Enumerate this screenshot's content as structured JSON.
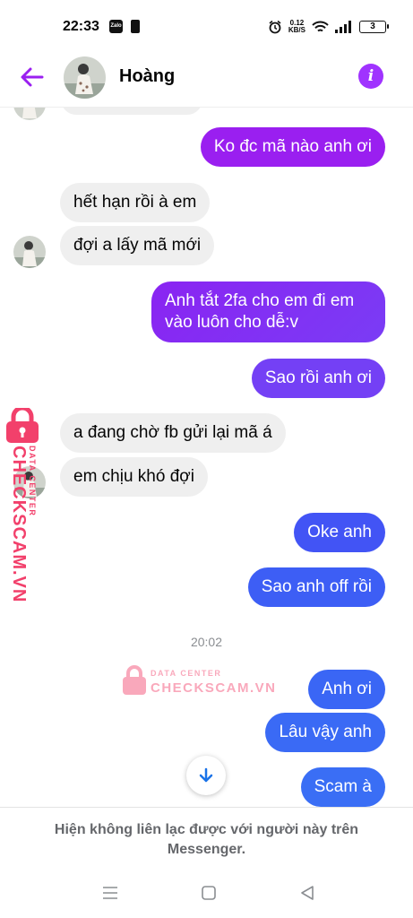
{
  "status_bar": {
    "time": "22:33",
    "app_icon_label": "Zalo",
    "net_speed_value": "0.12",
    "net_speed_unit": "KB/S",
    "battery": "3"
  },
  "header": {
    "contact_name": "Hoàng",
    "accent_color": "#a033ff"
  },
  "messages": [
    {
      "direction": "in",
      "text": ""
    },
    {
      "direction": "out",
      "text": "Ko đc mã nào anh ơi"
    },
    {
      "direction": "in",
      "text": "hết hạn rồi à em"
    },
    {
      "direction": "in",
      "text": "đợi a lấy mã mới"
    },
    {
      "direction": "out",
      "text": "Anh tắt 2fa cho em đi em vào luôn cho dễ:v"
    },
    {
      "direction": "out",
      "text": "Sao rồi anh ơi"
    },
    {
      "direction": "in",
      "text": "a đang chờ fb gửi lại mã á"
    },
    {
      "direction": "in",
      "text": "em chịu khó đợi"
    },
    {
      "direction": "out",
      "text": "Oke anh"
    },
    {
      "direction": "out",
      "text": "Sao anh off rồi"
    },
    {
      "direction": "out",
      "text": "Anh ơi"
    },
    {
      "direction": "out",
      "text": "Lâu vậy anh"
    },
    {
      "direction": "out",
      "text": "Scam à"
    }
  ],
  "timestamp": "20:02",
  "watermark": {
    "brand": "CHECKSCAM.VN",
    "sub": "DATA CENTER",
    "color": "#f2406b"
  },
  "notice": "Hiện không liên lạc được với người này trên Messenger.",
  "colors": {
    "bubble_purple": "#9a1ff0",
    "bubble_violet": "#7a3cf5",
    "bubble_blue": "#3d5ef5",
    "bubble_incoming": "#efefef"
  }
}
